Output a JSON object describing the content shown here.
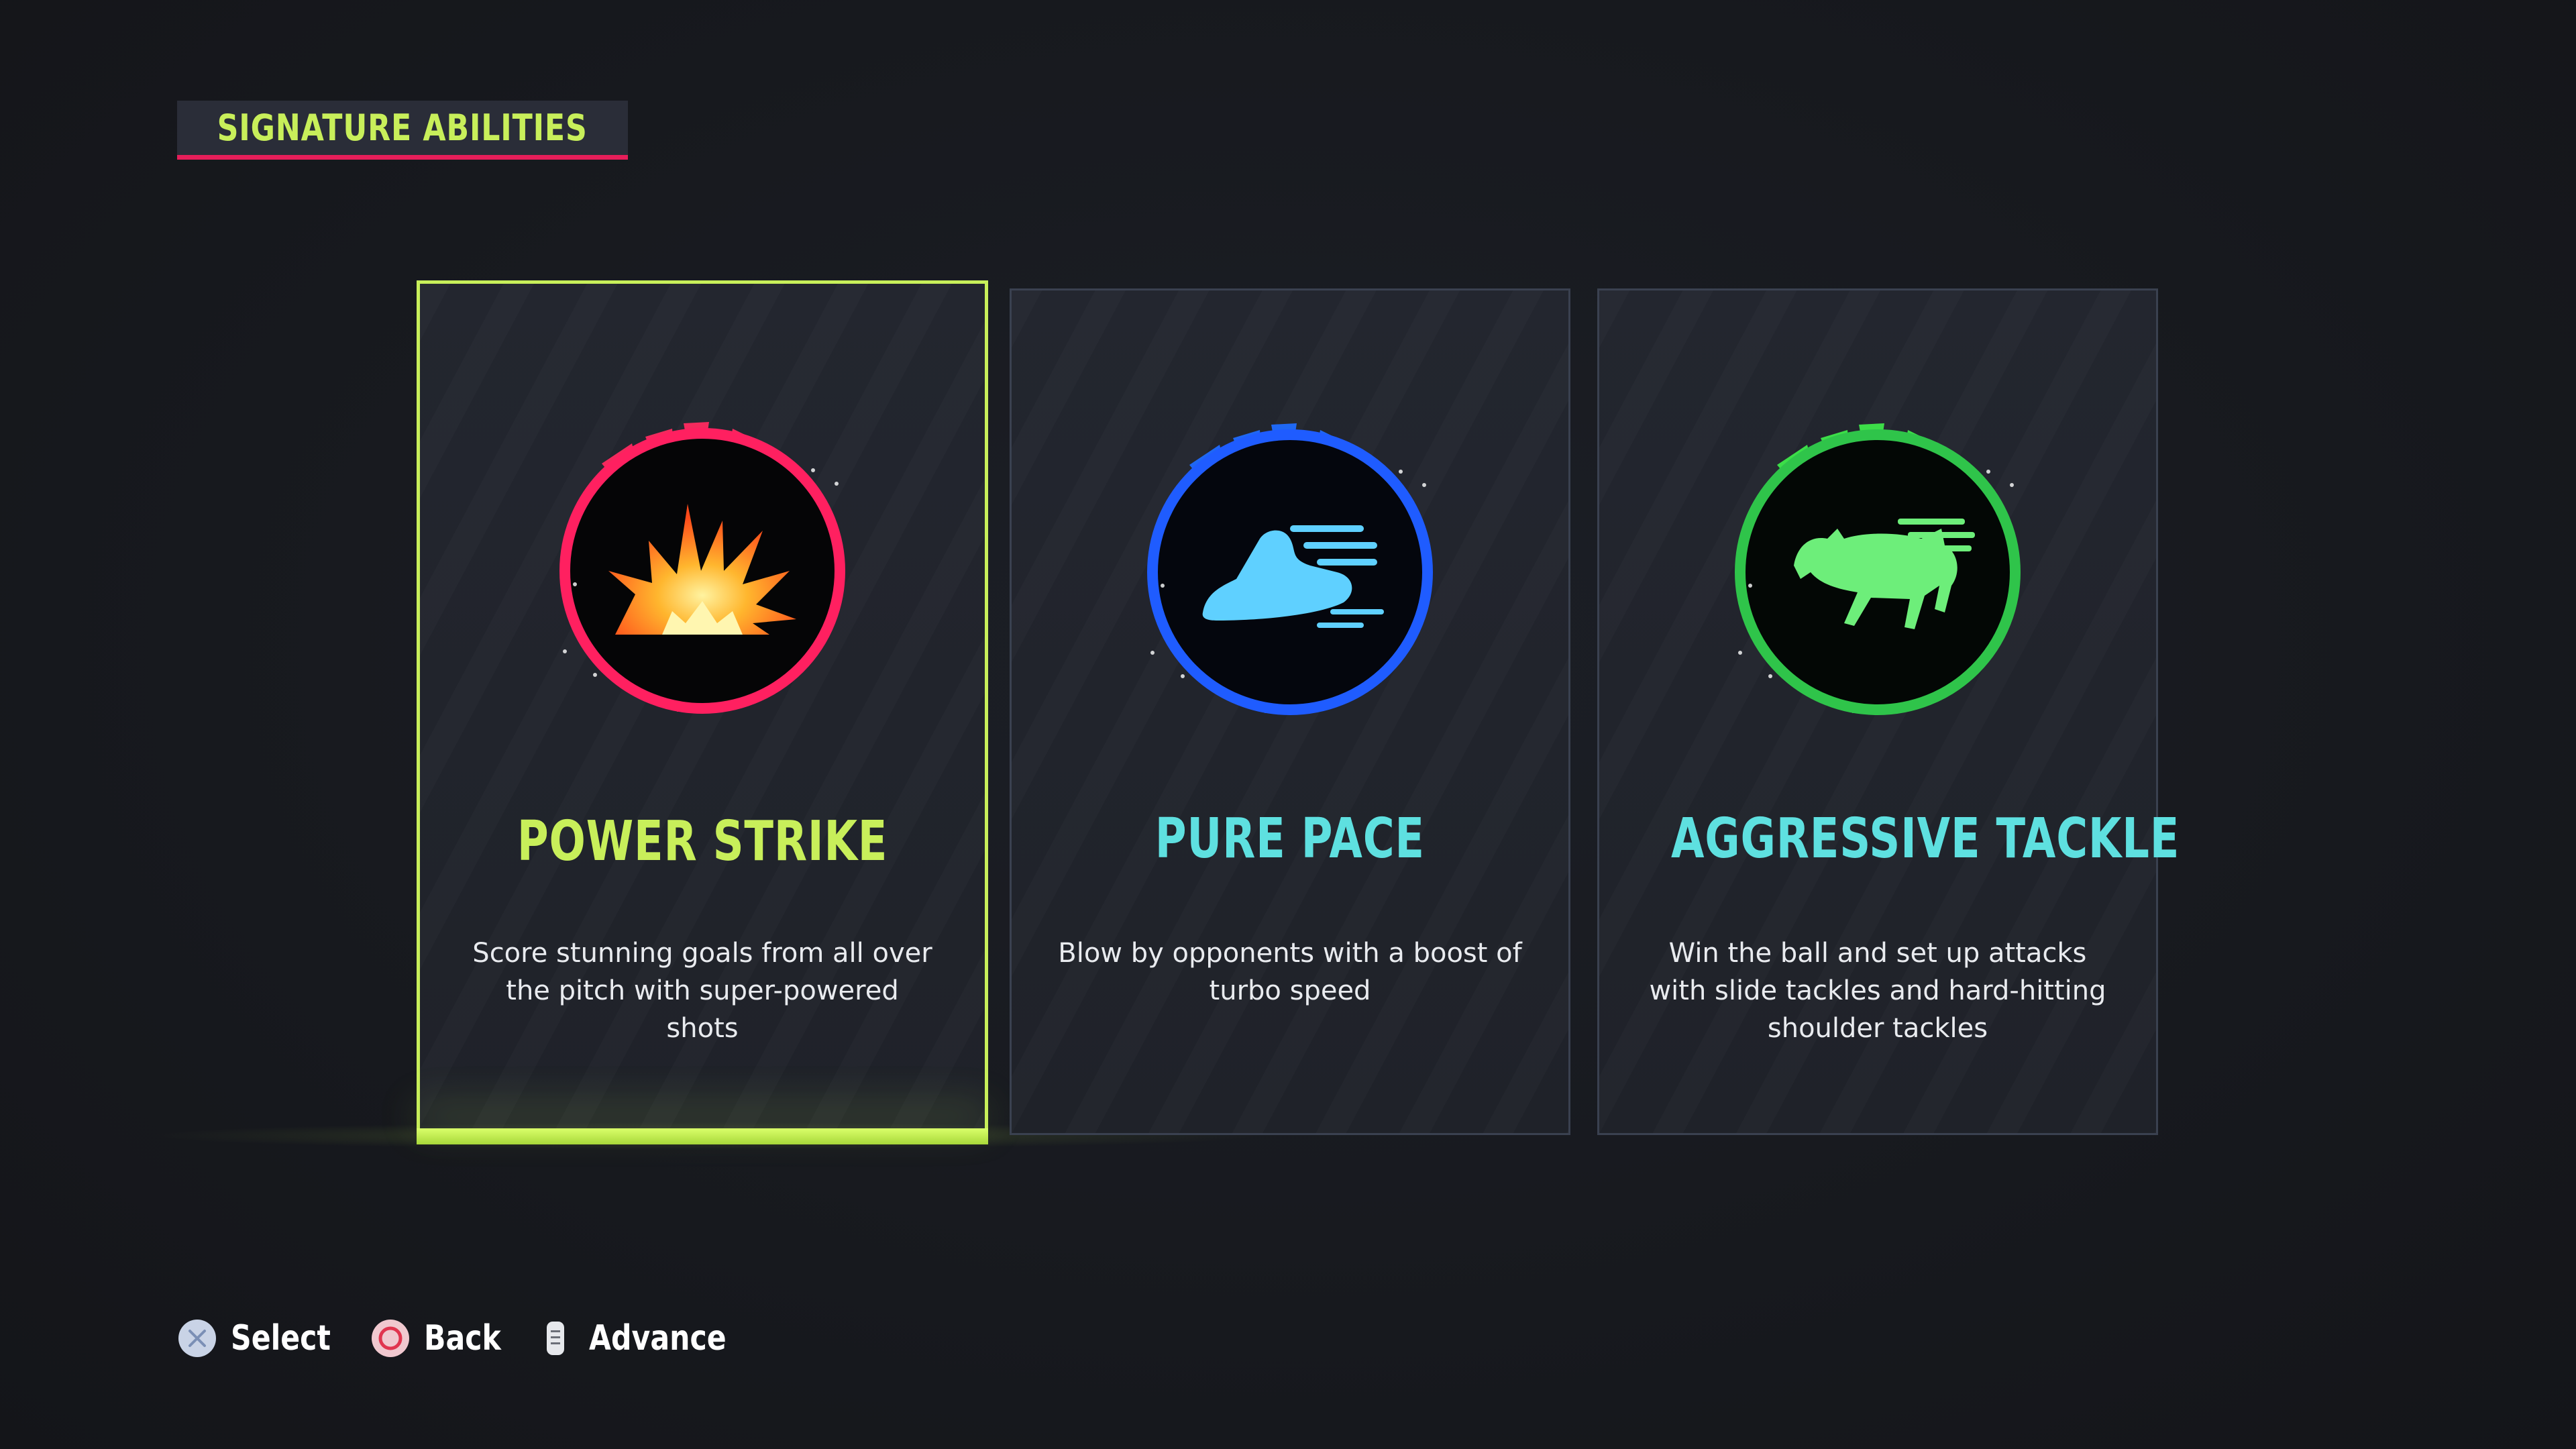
{
  "header": {
    "title": "SIGNATURE ABILITIES"
  },
  "cards": [
    {
      "title": "POWER STRIKE",
      "description": "Score stunning goals from all over the pitch with super-powered shots",
      "icon": "explosion-icon",
      "accent_color": "#ff1f5a",
      "selected": true
    },
    {
      "title": "PURE PACE",
      "description": "Blow by opponents with a boost of turbo speed",
      "icon": "shoe-icon",
      "accent_color": "#1f6bff",
      "selected": false
    },
    {
      "title": "AGGRESSIVE TACKLE",
      "description": "Win the ball and set up attacks with slide tackles and hard-hitting shoulder tackles",
      "icon": "bull-icon",
      "accent_color": "#2fe04a",
      "selected": false
    }
  ],
  "footer": {
    "select_label": "Select",
    "back_label": "Back",
    "advance_label": "Advance",
    "select_icon": "cross-button-icon",
    "back_icon": "circle-button-icon",
    "advance_icon": "touchpad-button-icon"
  },
  "colors": {
    "background": "#17191e",
    "highlight": "#c8ef5a",
    "header_underline": "#e61e5a",
    "title_teal": "#5ee0e0"
  }
}
